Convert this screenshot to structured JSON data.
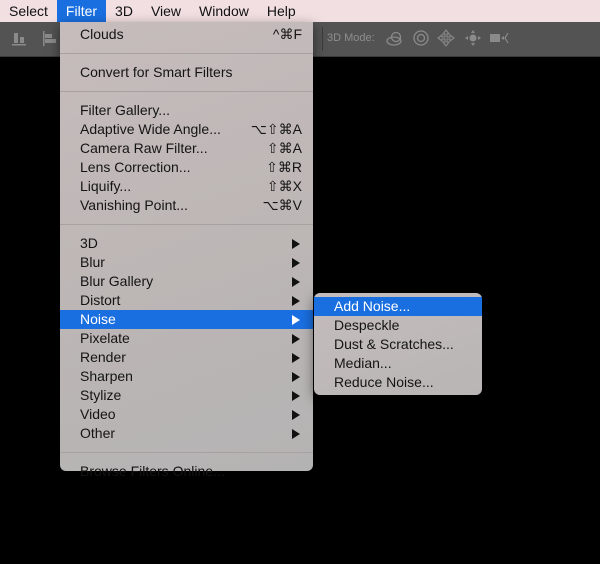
{
  "menubar": {
    "items": [
      {
        "label": "Select"
      },
      {
        "label": "Filter",
        "active": true
      },
      {
        "label": "3D"
      },
      {
        "label": "View"
      },
      {
        "label": "Window"
      },
      {
        "label": "Help"
      }
    ]
  },
  "options_bar": {
    "mode_label": "3D Mode:",
    "icons": [
      "align-bottom-icon",
      "align-left-icon",
      "orbit-3d-icon",
      "roll-3d-icon",
      "drag-3d-icon",
      "slide-3d-icon",
      "scale-3d-icon"
    ]
  },
  "filter_menu": {
    "groups": [
      [
        {
          "label": "Clouds",
          "shortcut": "^⌘F"
        }
      ],
      [
        {
          "label": "Convert for Smart Filters"
        }
      ],
      [
        {
          "label": "Filter Gallery..."
        },
        {
          "label": "Adaptive Wide Angle...",
          "shortcut": "⌥⇧⌘A"
        },
        {
          "label": "Camera Raw Filter...",
          "shortcut": "⇧⌘A"
        },
        {
          "label": "Lens Correction...",
          "shortcut": "⇧⌘R"
        },
        {
          "label": "Liquify...",
          "shortcut": "⇧⌘X"
        },
        {
          "label": "Vanishing Point...",
          "shortcut": "⌥⌘V"
        }
      ],
      [
        {
          "label": "3D",
          "submenu": true
        },
        {
          "label": "Blur",
          "submenu": true
        },
        {
          "label": "Blur Gallery",
          "submenu": true
        },
        {
          "label": "Distort",
          "submenu": true
        },
        {
          "label": "Noise",
          "submenu": true,
          "highlighted": true
        },
        {
          "label": "Pixelate",
          "submenu": true
        },
        {
          "label": "Render",
          "submenu": true
        },
        {
          "label": "Sharpen",
          "submenu": true
        },
        {
          "label": "Stylize",
          "submenu": true
        },
        {
          "label": "Video",
          "submenu": true
        },
        {
          "label": "Other",
          "submenu": true
        }
      ],
      [
        {
          "label": "Browse Filters Online..."
        }
      ]
    ]
  },
  "noise_submenu": {
    "items": [
      {
        "label": "Add Noise...",
        "highlighted": true
      },
      {
        "label": "Despeckle"
      },
      {
        "label": "Dust & Scratches..."
      },
      {
        "label": "Median..."
      },
      {
        "label": "Reduce Noise..."
      }
    ]
  },
  "colors": {
    "highlight": "#1a6fe0",
    "menubar_bg": "#f1dfe1",
    "options_bar_bg": "#535353"
  }
}
